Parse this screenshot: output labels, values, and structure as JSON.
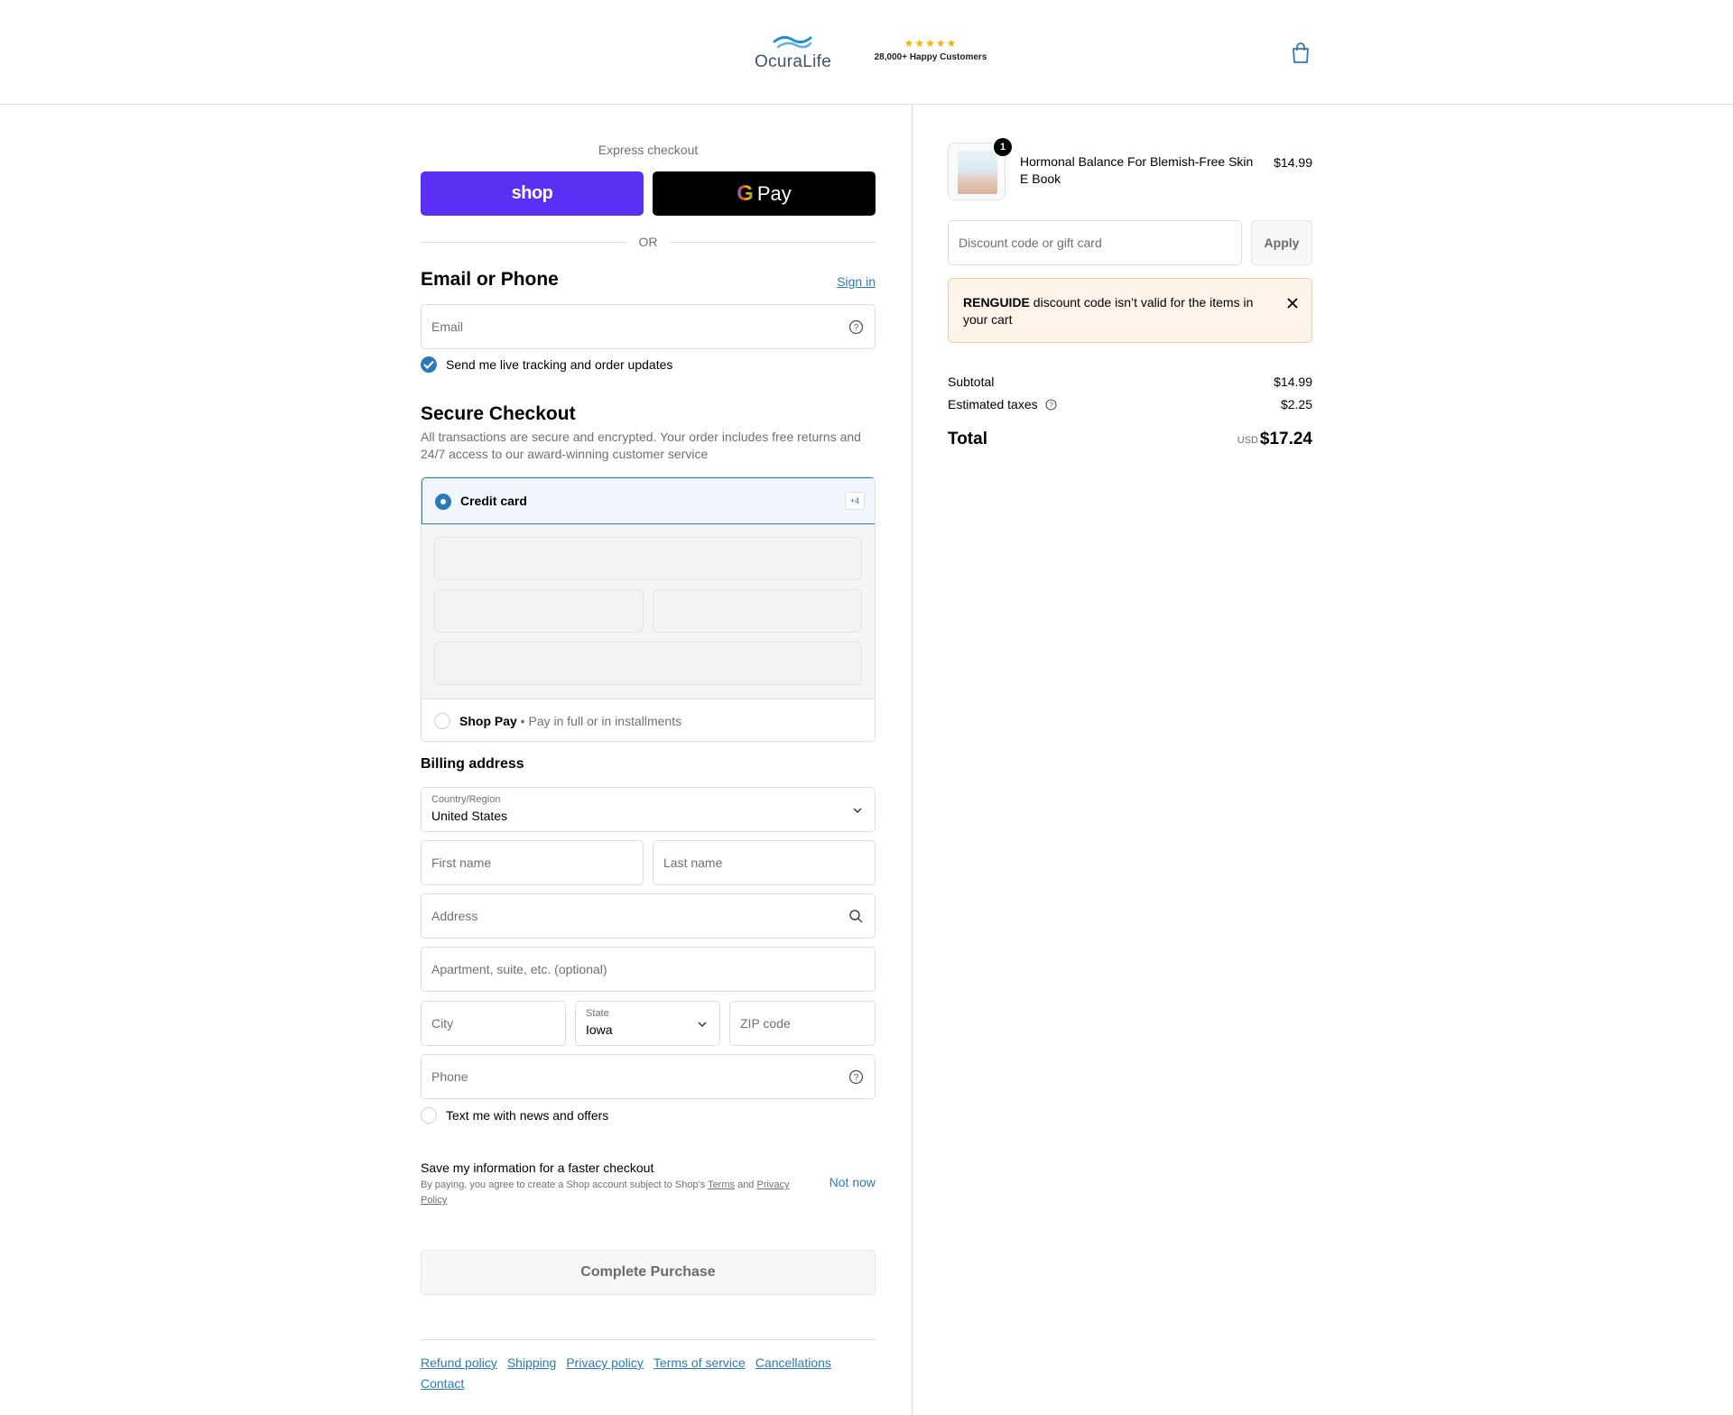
{
  "header": {
    "brand": "OcuraLife",
    "stars": "★★★★★",
    "rating_text": "28,000+ Happy Customers"
  },
  "express": {
    "label": "Express checkout",
    "shop_label": "shop",
    "gpay_g": "G",
    "gpay_label": "Pay",
    "or": "OR"
  },
  "contact": {
    "title": "Email or Phone",
    "sign_in": "Sign in",
    "email_placeholder": "Email",
    "tracking_label": "Send me live tracking and order updates",
    "tracking_checked": true
  },
  "secure": {
    "title": "Secure Checkout",
    "description": "All transactions are secure and encrypted. Your order includes free returns and 24/7 access to our award-winning customer service"
  },
  "payment": {
    "credit_card_label": "Credit card",
    "more_badge": "+4",
    "shop_pay_label": "Shop Pay",
    "shop_pay_sub": " • Pay in full or in installments"
  },
  "billing": {
    "title": "Billing address",
    "country_label": "Country/Region",
    "country_value": "United States",
    "first_name": "First name",
    "last_name": "Last name",
    "address": "Address",
    "apartment": "Apartment, suite, etc. (optional)",
    "city": "City",
    "state_label": "State",
    "state_value": "Iowa",
    "zip": "ZIP code",
    "phone": "Phone",
    "text_offers_label": "Text me with news and offers"
  },
  "save_info": {
    "title": "Save my information for a faster checkout",
    "desc_prefix": "By paying, you agree to create a Shop account subject to Shop's ",
    "terms": "Terms",
    "and": " and ",
    "privacy": "Privacy Policy",
    "not_now": "Not now"
  },
  "complete_button": "Complete Purchase",
  "footer": {
    "links": [
      "Refund policy",
      "Shipping",
      "Privacy policy",
      "Terms of service",
      "Cancellations",
      "Contact"
    ]
  },
  "order": {
    "quantity": "1",
    "product_name": "Hormonal Balance For Blemish-Free Skin E Book",
    "product_price": "$14.99",
    "discount_placeholder": "Discount code or gift card",
    "apply": "Apply",
    "alert_code": "RENGUIDE",
    "alert_message": " discount code isn’t valid for the items in your cart",
    "subtotal_label": "Subtotal",
    "subtotal_value": "$14.99",
    "taxes_label": "Estimated taxes",
    "taxes_value": "$2.25",
    "total_label": "Total",
    "total_currency": "USD",
    "total_value": "$17.24"
  },
  "colors": {
    "accent": "#2a7ab8",
    "shop_purple": "#5a31f4",
    "alert_bg": "#fff4ea"
  }
}
